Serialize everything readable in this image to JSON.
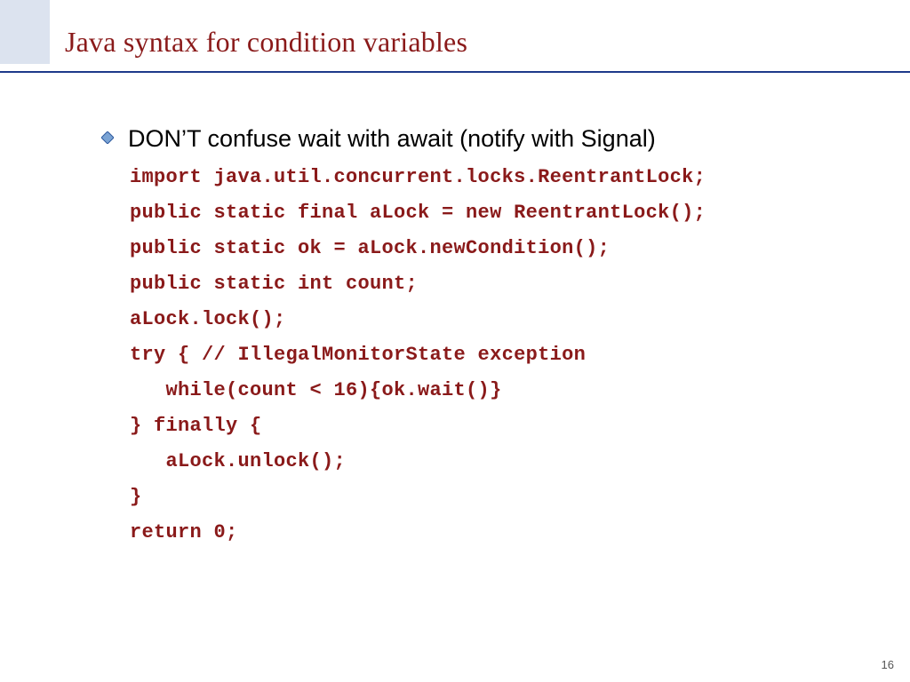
{
  "slide": {
    "title": "Java syntax for condition variables",
    "page_number": "16"
  },
  "bullet": {
    "text": "DON’T confuse wait with await (notify with Signal)"
  },
  "code": {
    "lines": [
      "import java.util.concurrent.locks.ReentrantLock;",
      "public static final aLock = new ReentrantLock();",
      "public static ok = aLock.newCondition();",
      "public static int count;",
      "aLock.lock();",
      "try { // IllegalMonitorState exception",
      "   while(count < 16){ok.wait()}",
      "} finally {",
      "   aLock.unlock();",
      "}",
      "return 0;"
    ]
  },
  "colors": {
    "title": "#8a1a1a",
    "rule": "#1d3a8a",
    "box": "#dce3ef",
    "code": "#8a1a1a"
  }
}
